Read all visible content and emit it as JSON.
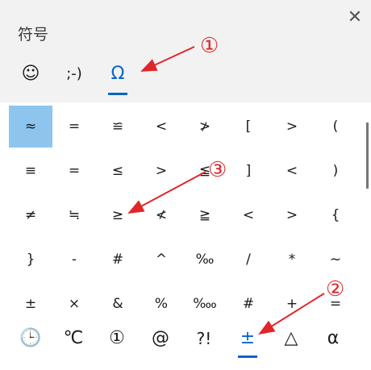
{
  "window": {
    "title": "符号",
    "close_label": "✕"
  },
  "tabs": [
    {
      "label": "☺",
      "icon": "smiley-icon"
    },
    {
      "label": ";-)",
      "icon": "emoticon-icon"
    },
    {
      "label": "Ω",
      "icon": "omega-icon",
      "active": true
    }
  ],
  "symbols": [
    [
      "≈",
      "=",
      "≌",
      "<",
      "≯",
      "[",
      ">",
      "("
    ],
    [
      "≡",
      "=",
      "≤",
      ">",
      "≦",
      "]",
      "<",
      ")"
    ],
    [
      "≠",
      "≒",
      "≥",
      "≮",
      "≧",
      "<",
      ">",
      "{"
    ],
    [
      "}",
      "-",
      "#",
      "^",
      "‰",
      "/",
      "*",
      "~"
    ],
    [
      "±",
      "×",
      "&",
      "%",
      "‱",
      "#",
      "+",
      "="
    ]
  ],
  "selected_symbol": "≈",
  "categories": [
    {
      "label": "🕒",
      "icon": "clock-icon"
    },
    {
      "label": "℃",
      "icon": "celsius-icon"
    },
    {
      "label": "①",
      "icon": "circled-one-icon"
    },
    {
      "label": "@",
      "icon": "at-sign-icon"
    },
    {
      "label": "?!",
      "icon": "interrobang-icon"
    },
    {
      "label": "±",
      "icon": "plus-minus-icon",
      "active": true
    },
    {
      "label": "△",
      "icon": "triangle-icon"
    },
    {
      "label": "α",
      "icon": "alpha-icon"
    }
  ],
  "annotations": [
    {
      "label": "①",
      "color": "#e0262a"
    },
    {
      "label": "②",
      "color": "#e0262a"
    },
    {
      "label": "③",
      "color": "#e0262a"
    }
  ]
}
